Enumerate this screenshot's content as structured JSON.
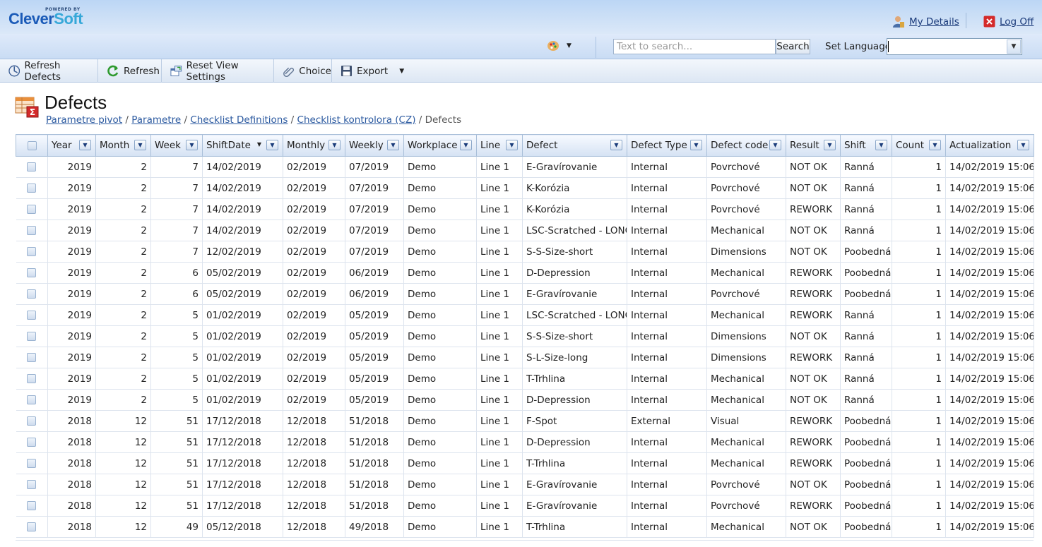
{
  "brand": {
    "powered_by": "POWERED BY",
    "name_a": "Clever",
    "name_b": "Soft"
  },
  "header": {
    "my_details": "My Details",
    "log_off": "Log Off"
  },
  "bar": {
    "search_placeholder": "Text to search...",
    "search_btn": "Search",
    "set_language": "Set Language",
    "language_value": ""
  },
  "toolbar": {
    "refresh_defects": "Refresh Defects",
    "refresh": "Refresh",
    "reset_view": "Reset View Settings",
    "choice": "Choice",
    "export": "Export"
  },
  "page": {
    "title": "Defects"
  },
  "breadcrumb": [
    "Parametre pivot",
    "Parametre",
    "Checklist Definitions",
    "Checklist kontrolora (CZ)",
    "Defects"
  ],
  "columns": [
    "Year",
    "Month",
    "Week",
    "ShiftDate",
    "Monthly",
    "Weekly",
    "Workplace",
    "Line",
    "Defect",
    "Defect Type",
    "Defect code",
    "Result",
    "Shift",
    "Count",
    "Actualization"
  ],
  "rows": [
    [
      "2019",
      "2",
      "7",
      "14/02/2019",
      "02/2019",
      "07/2019",
      "Demo",
      "Line 1",
      "E-Gravírovanie",
      "Internal",
      "Povrchové",
      "NOT OK",
      "Ranná",
      "1",
      "14/02/2019 15:06"
    ],
    [
      "2019",
      "2",
      "7",
      "14/02/2019",
      "02/2019",
      "07/2019",
      "Demo",
      "Line 1",
      "K-Korózia",
      "Internal",
      "Povrchové",
      "NOT OK",
      "Ranná",
      "1",
      "14/02/2019 15:06"
    ],
    [
      "2019",
      "2",
      "7",
      "14/02/2019",
      "02/2019",
      "07/2019",
      "Demo",
      "Line 1",
      "K-Korózia",
      "Internal",
      "Povrchové",
      "REWORK",
      "Ranná",
      "1",
      "14/02/2019 15:06"
    ],
    [
      "2019",
      "2",
      "7",
      "14/02/2019",
      "02/2019",
      "07/2019",
      "Demo",
      "Line 1",
      "LSC-Scratched - LONG",
      "Internal",
      "Mechanical",
      "NOT OK",
      "Ranná",
      "1",
      "14/02/2019 15:06"
    ],
    [
      "2019",
      "2",
      "7",
      "12/02/2019",
      "02/2019",
      "07/2019",
      "Demo",
      "Line 1",
      "S-S-Size-short",
      "Internal",
      "Dimensions",
      "NOT OK",
      "Poobedná",
      "1",
      "14/02/2019 15:06"
    ],
    [
      "2019",
      "2",
      "6",
      "05/02/2019",
      "02/2019",
      "06/2019",
      "Demo",
      "Line 1",
      "D-Depression",
      "Internal",
      "Mechanical",
      "REWORK",
      "Poobedná",
      "1",
      "14/02/2019 15:06"
    ],
    [
      "2019",
      "2",
      "6",
      "05/02/2019",
      "02/2019",
      "06/2019",
      "Demo",
      "Line 1",
      "E-Gravírovanie",
      "Internal",
      "Povrchové",
      "REWORK",
      "Poobedná",
      "1",
      "14/02/2019 15:06"
    ],
    [
      "2019",
      "2",
      "5",
      "01/02/2019",
      "02/2019",
      "05/2019",
      "Demo",
      "Line 1",
      "LSC-Scratched - LONG",
      "Internal",
      "Mechanical",
      "REWORK",
      "Ranná",
      "1",
      "14/02/2019 15:06"
    ],
    [
      "2019",
      "2",
      "5",
      "01/02/2019",
      "02/2019",
      "05/2019",
      "Demo",
      "Line 1",
      "S-S-Size-short",
      "Internal",
      "Dimensions",
      "NOT OK",
      "Ranná",
      "1",
      "14/02/2019 15:06"
    ],
    [
      "2019",
      "2",
      "5",
      "01/02/2019",
      "02/2019",
      "05/2019",
      "Demo",
      "Line 1",
      "S-L-Size-long",
      "Internal",
      "Dimensions",
      "REWORK",
      "Ranná",
      "1",
      "14/02/2019 15:06"
    ],
    [
      "2019",
      "2",
      "5",
      "01/02/2019",
      "02/2019",
      "05/2019",
      "Demo",
      "Line 1",
      "T-Trhlina",
      "Internal",
      "Mechanical",
      "NOT OK",
      "Ranná",
      "1",
      "14/02/2019 15:06"
    ],
    [
      "2019",
      "2",
      "5",
      "01/02/2019",
      "02/2019",
      "05/2019",
      "Demo",
      "Line 1",
      "D-Depression",
      "Internal",
      "Mechanical",
      "NOT OK",
      "Ranná",
      "1",
      "14/02/2019 15:06"
    ],
    [
      "2018",
      "12",
      "51",
      "17/12/2018",
      "12/2018",
      "51/2018",
      "Demo",
      "Line 1",
      "F-Spot",
      "External",
      "Visual",
      "REWORK",
      "Poobedná",
      "1",
      "14/02/2019 15:06"
    ],
    [
      "2018",
      "12",
      "51",
      "17/12/2018",
      "12/2018",
      "51/2018",
      "Demo",
      "Line 1",
      "D-Depression",
      "Internal",
      "Mechanical",
      "REWORK",
      "Poobedná",
      "1",
      "14/02/2019 15:06"
    ],
    [
      "2018",
      "12",
      "51",
      "17/12/2018",
      "12/2018",
      "51/2018",
      "Demo",
      "Line 1",
      "T-Trhlina",
      "Internal",
      "Mechanical",
      "REWORK",
      "Poobedná",
      "1",
      "14/02/2019 15:06"
    ],
    [
      "2018",
      "12",
      "51",
      "17/12/2018",
      "12/2018",
      "51/2018",
      "Demo",
      "Line 1",
      "E-Gravírovanie",
      "Internal",
      "Povrchové",
      "NOT OK",
      "Poobedná",
      "1",
      "14/02/2019 15:06"
    ],
    [
      "2018",
      "12",
      "51",
      "17/12/2018",
      "12/2018",
      "51/2018",
      "Demo",
      "Line 1",
      "E-Gravírovanie",
      "Internal",
      "Povrchové",
      "REWORK",
      "Poobedná",
      "1",
      "14/02/2019 15:06"
    ],
    [
      "2018",
      "12",
      "49",
      "05/12/2018",
      "12/2018",
      "49/2018",
      "Demo",
      "Line 1",
      "T-Trhlina",
      "Internal",
      "Mechanical",
      "NOT OK",
      "Poobedná",
      "1",
      "14/02/2019 15:06"
    ]
  ],
  "icons": {
    "details": "user-icon",
    "logoff": "power-icon",
    "theme": "palette-icon",
    "refresh_defects": "globe-icon",
    "refresh": "refresh-icon",
    "reset": "window-icon",
    "choice": "paperclip-icon",
    "export": "floppy-icon",
    "title": "pivot-table-icon"
  },
  "colors": {
    "link": "#2c5aa0",
    "header_bg": "#bcd6f5",
    "logo_blue": "#1b5bb8",
    "logo_cyan": "#36a8d8"
  }
}
